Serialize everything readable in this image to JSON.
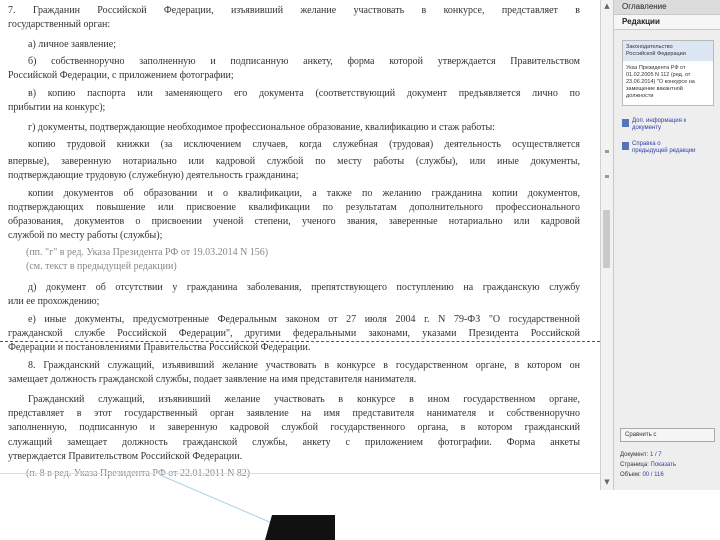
{
  "sidebar": {
    "tabs": [
      {
        "label": "Оглавление"
      },
      {
        "label": "Редакции"
      }
    ],
    "info_box": {
      "lines": [
        "Законодательство",
        "Российской Федерации",
        "Указ Президента РФ от",
        "01.02.2005 N 112 (ред. от",
        "23.06.2014) \"О конкурсе на",
        "замещение вакантной",
        "должности"
      ]
    },
    "links": [
      {
        "icon": "document-icon",
        "text1": "Доп. информация к",
        "text2": "документу"
      },
      {
        "icon": "document-icon",
        "text1": "Справка о",
        "text2": "предыдущей редакции"
      }
    ],
    "footer": {
      "button": "Сравнить с",
      "doc_label": "Документ:",
      "doc_value": "1 / 7",
      "page_label": "Страница:",
      "page_value": "Показать",
      "size_label": "Объем:",
      "size_value": "00 / 116"
    }
  },
  "document": {
    "lines": [
      "7. Гражданин Российской Федерации, изъявивший желание участвовать в конкурсе, представляет в",
      "государственный орган:",
      "а) личное заявление;",
      "б) собственноручно заполненную и подписанную анкету, форма которой утверждается Правительством",
      "Российской Федерации, с приложением фотографии;",
      "в) копию паспорта или заменяющего его документа (соответствующий документ предъявляется лично по",
      "прибытии на конкурс);",
      "г) документы, подтверждающие необходимое профессиональное образование, квалификацию и стаж работы:",
      "копию трудовой книжки (за исключением случаев, когда служебная (трудовая) деятельность осуществляется",
      "впервые), заверенную нотариально или кадровой службой по месту работы (службы), или иные документы,",
      "подтверждающие трудовую (служебную) деятельность гражданина;",
      "копии документов об образовании и о квалификации, а также по желанию гражданина копии документов,",
      "подтверждающих повышение или присвоение квалификации по результатам дополнительного профессионального",
      "образования, документов о присвоении ученой степени, ученого звания, заверенные нотариально или кадровой",
      "службой по месту работы (службы);",
      "(пп. \"г\" в ред. Указа Президента РФ от 19.03.2014 N 156)",
      "(см. текст в предыдущей редакции)",
      "д) документ об отсутствии у гражданина заболевания, препятствующего поступлению на гражданскую службу",
      "или ее прохождению;",
      "е) иные документы, предусмотренные Федеральным законом от 27 июля 2004 г. N 79-ФЗ \"О государственной",
      "гражданской службе Российской Федерации\", другими федеральными законами, указами Президента Российской",
      "Федерации и постановлениями Правительства Российской Федерации.",
      "8. Гражданский служащий, изъявивший желание участвовать в конкурсе в государственном органе, в котором он",
      "замещает должность гражданской службы, подает заявление на имя представителя нанимателя.",
      "Гражданский служащий, изъявивший желание участвовать в конкурсе в ином государственном органе,",
      "представляет в этот государственный орган заявление на имя представителя нанимателя и собственноручно",
      "заполненную, подписанную и заверенную кадровой службой государственного органа, в котором гражданский",
      "служащий замещает должность гражданской службы, анкету с приложением фотографии. Форма анкеты",
      "утверждается Правительством Российской Федерации.",
      "(п. 8 в ред. Указа Президента РФ от 22.01.2011 N 82)"
    ]
  },
  "colors": {
    "link": "#2a3fa6",
    "muted": "#888888",
    "text": "#333333"
  }
}
